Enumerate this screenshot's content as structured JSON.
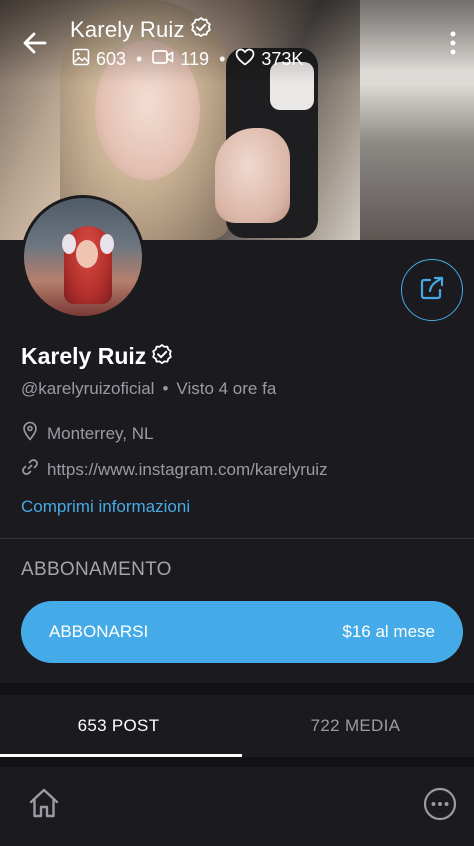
{
  "header": {
    "title": "Karely Ruiz",
    "stats": {
      "photos": "603",
      "videos": "119",
      "likes": "373K"
    },
    "icons": {
      "back": "back-arrow-icon",
      "verified": "verified-badge-icon",
      "photos": "image-icon",
      "videos": "video-camera-icon",
      "likes": "heart-icon",
      "more": "kebab-menu-icon"
    }
  },
  "profile": {
    "name": "Karely Ruiz",
    "handle": "@karelyruizoficial",
    "last_seen": "Visto 4 ore fa",
    "location": "Monterrey, NL",
    "link": "https://www.instagram.com/karelyruiz",
    "collapse_label": "Comprimi informazioni"
  },
  "subscription": {
    "section_title": "ABBONAMENTO",
    "button_label": "ABBONARSI",
    "price": "$16 al mese"
  },
  "tabs": [
    {
      "label": "653 POST",
      "active": true
    },
    {
      "label": "722 MEDIA",
      "active": false
    }
  ],
  "bottom_nav": {
    "icons": [
      "home-icon",
      "more-circle-icon"
    ]
  },
  "colors": {
    "accent": "#45abe8",
    "background": "#1b1b1f",
    "muted_text": "#9a9aa3"
  }
}
